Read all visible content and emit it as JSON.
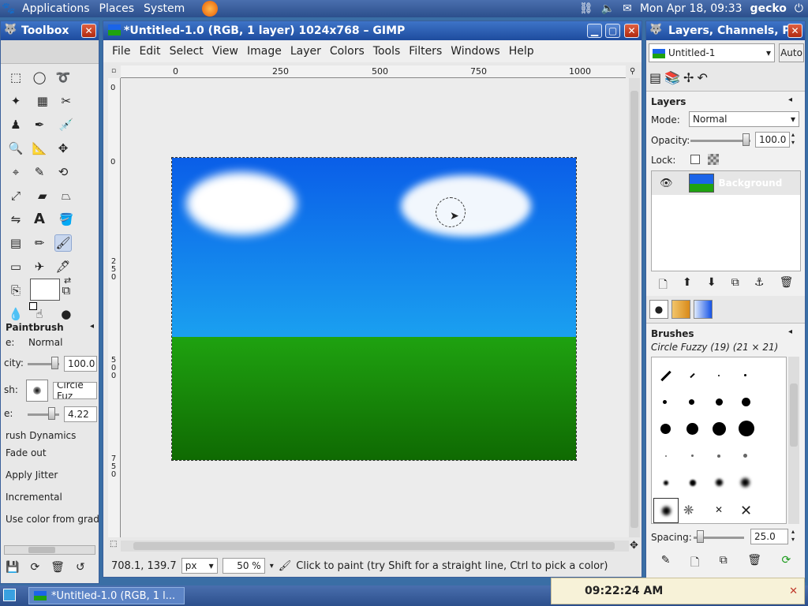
{
  "panel": {
    "menus": [
      "Applications",
      "Places",
      "System"
    ],
    "datetime": "Mon Apr 18, 09:33",
    "host": "gecko"
  },
  "toolbox": {
    "title": "Toolbox",
    "tool_options_title": "Paintbrush",
    "mode_label": "e:",
    "mode_value": "Normal",
    "opacity_label": "city:",
    "opacity_value": "100.0",
    "brush_label": "sh:",
    "brush_value": "Circle Fuz",
    "scale_label": "e:",
    "scale_value": "4.22",
    "dynamics_label": "rush Dynamics",
    "options": [
      "Fade out",
      "Apply Jitter",
      "Incremental",
      "Use color from gradi"
    ]
  },
  "image_window": {
    "title": "*Untitled-1.0 (RGB, 1 layer) 1024x768 – GIMP",
    "menus": [
      "File",
      "Edit",
      "Select",
      "View",
      "Image",
      "Layer",
      "Colors",
      "Tools",
      "Filters",
      "Windows",
      "Help"
    ],
    "ruler_top": [
      "0",
      "250",
      "500",
      "750",
      "1000"
    ],
    "ruler_left": [
      "0",
      "250",
      "500",
      "750"
    ],
    "coords": "708.1, 139.7",
    "unit": "px",
    "zoom": "50 %",
    "status_msg": "Click to paint (try Shift for a straight line, Ctrl to pick a color)"
  },
  "dock": {
    "title": "Layers, Channels, P",
    "image_select": "Untitled-1",
    "auto_label": "Auto",
    "layers_title": "Layers",
    "mode_label": "Mode:",
    "mode_value": "Normal",
    "opacity_label": "Opacity:",
    "opacity_value": "100.0",
    "lock_label": "Lock:",
    "layer_name": "Background",
    "brushes_title": "Brushes",
    "brush_name": "Circle Fuzzy (19) (21 × 21)",
    "spacing_label": "Spacing:",
    "spacing_value": "25.0"
  },
  "taskbar": {
    "task_label": "*Untitled-1.0 (RGB, 1 l...",
    "clock": "09:22:24 AM"
  },
  "colors": {
    "sky_top": "#0a5ee8",
    "sky_bottom": "#1aa0f0",
    "grass_top": "#1fa210",
    "grass_bottom": "#0f6a02",
    "fg_color": "#ffffff",
    "bg_color": "#1553e6"
  }
}
